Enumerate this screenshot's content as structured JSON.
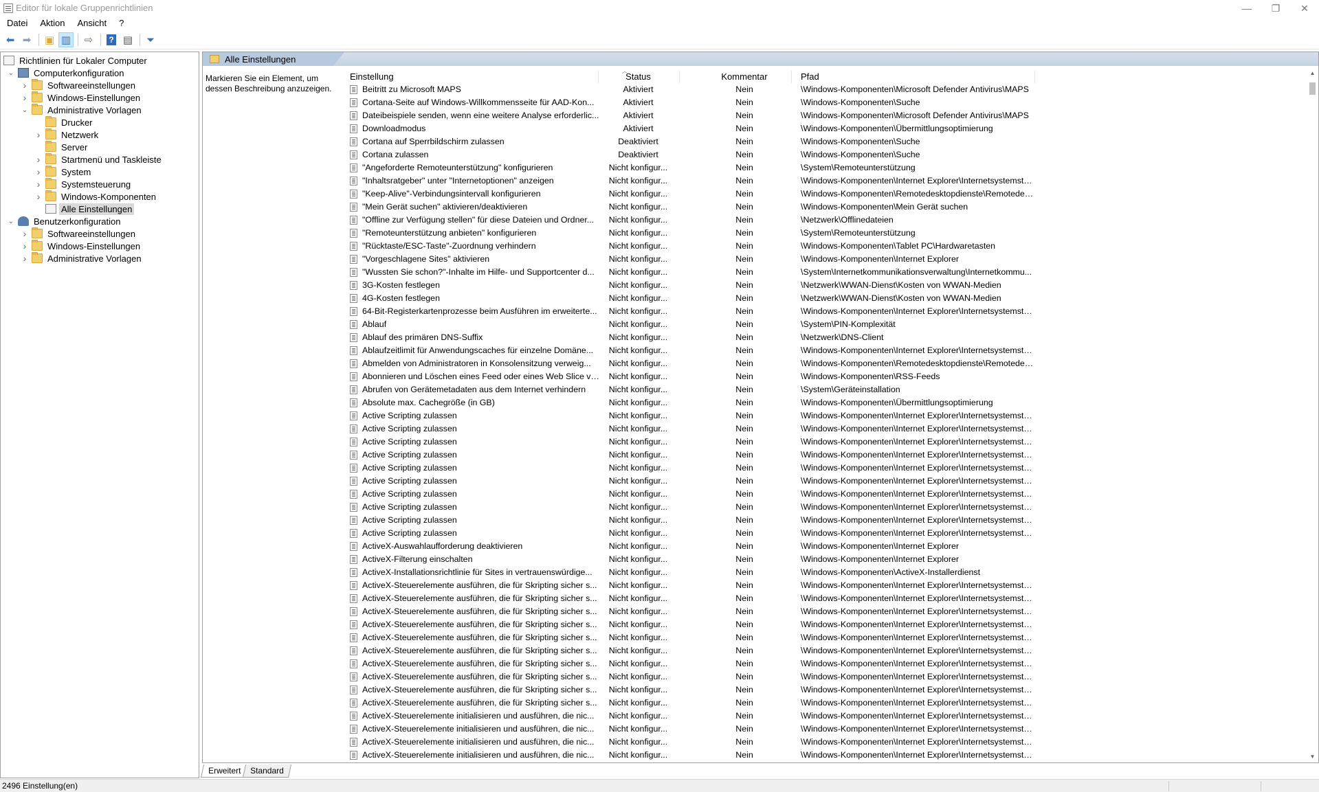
{
  "window": {
    "title": "Editor für lokale Gruppenrichtlinien",
    "controls": {
      "minimize": "—",
      "maximize": "❐",
      "close": "✕"
    }
  },
  "menu": [
    "Datei",
    "Aktion",
    "Ansicht",
    "?"
  ],
  "toolbar": {
    "buttons": [
      "back-icon",
      "forward-icon",
      "up-folder-icon",
      "show-hide-tree-icon",
      "export-list-icon",
      "help-icon",
      "properties-icon",
      "filter-icon"
    ]
  },
  "tree": {
    "root": "Richtlinien für Lokaler Computer",
    "items": [
      {
        "label": "Computerkonfiguration",
        "level": 1,
        "expander": "expanded",
        "icon": "computer-icon"
      },
      {
        "label": "Softwareeinstellungen",
        "level": 2,
        "expander": "collapsed",
        "icon": "folder-icon"
      },
      {
        "label": "Windows-Einstellungen",
        "level": 2,
        "expander": "collapsed",
        "icon": "folder-icon"
      },
      {
        "label": "Administrative Vorlagen",
        "level": 2,
        "expander": "expanded",
        "icon": "folder-icon"
      },
      {
        "label": "Drucker",
        "level": 3,
        "expander": "none",
        "icon": "folder-icon"
      },
      {
        "label": "Netzwerk",
        "level": 3,
        "expander": "collapsed",
        "icon": "folder-icon"
      },
      {
        "label": "Server",
        "level": 3,
        "expander": "none",
        "icon": "folder-icon"
      },
      {
        "label": "Startmenü und Taskleiste",
        "level": 3,
        "expander": "collapsed",
        "icon": "folder-icon"
      },
      {
        "label": "System",
        "level": 3,
        "expander": "collapsed",
        "icon": "folder-icon"
      },
      {
        "label": "Systemsteuerung",
        "level": 3,
        "expander": "collapsed",
        "icon": "folder-icon"
      },
      {
        "label": "Windows-Komponenten",
        "level": 3,
        "expander": "collapsed",
        "icon": "folder-icon"
      },
      {
        "label": "Alle Einstellungen",
        "level": 3,
        "expander": "none",
        "icon": "all-settings-icon",
        "selected": true
      },
      {
        "label": "Benutzerkonfiguration",
        "level": 1,
        "expander": "expanded",
        "icon": "user-icon"
      },
      {
        "label": "Softwareeinstellungen",
        "level": 2,
        "expander": "collapsed",
        "icon": "folder-icon"
      },
      {
        "label": "Windows-Einstellungen",
        "level": 2,
        "expander": "collapsed",
        "icon": "folder-icon"
      },
      {
        "label": "Administrative Vorlagen",
        "level": 2,
        "expander": "collapsed",
        "icon": "folder-icon"
      }
    ]
  },
  "main": {
    "header": "Alle Einstellungen",
    "description": "Markieren Sie ein Element, um dessen Beschreibung anzuzeigen.",
    "columns": [
      "Einstellung",
      "Status",
      "Kommentar",
      "Pfad"
    ],
    "rows": [
      [
        "Beitritt zu Microsoft MAPS",
        "Aktiviert",
        "Nein",
        "\\Windows-Komponenten\\Microsoft Defender Antivirus\\MAPS"
      ],
      [
        "Cortana-Seite auf Windows-Willkommensseite für AAD-Kon...",
        "Aktiviert",
        "Nein",
        "\\Windows-Komponenten\\Suche"
      ],
      [
        "Dateibeispiele senden, wenn eine weitere Analyse erforderlic...",
        "Aktiviert",
        "Nein",
        "\\Windows-Komponenten\\Microsoft Defender Antivirus\\MAPS"
      ],
      [
        "Downloadmodus",
        "Aktiviert",
        "Nein",
        "\\Windows-Komponenten\\Übermittlungsoptimierung"
      ],
      [
        "Cortana auf Sperrbildschirm zulassen",
        "Deaktiviert",
        "Nein",
        "\\Windows-Komponenten\\Suche"
      ],
      [
        "Cortana zulassen",
        "Deaktiviert",
        "Nein",
        "\\Windows-Komponenten\\Suche"
      ],
      [
        "\"Angeforderte Remoteunterstützung\" konfigurieren",
        "Nicht konfigur...",
        "Nein",
        "\\System\\Remoteunterstützung"
      ],
      [
        "\"Inhaltsratgeber\" unter \"Internetoptionen\" anzeigen",
        "Nicht konfigur...",
        "Nein",
        "\\Windows-Komponenten\\Internet Explorer\\Internetsystemste..."
      ],
      [
        "\"Keep-Alive\"-Verbindungsintervall konfigurieren",
        "Nicht konfigur...",
        "Nein",
        "\\Windows-Komponenten\\Remotedesktopdienste\\Remotedes..."
      ],
      [
        "\"Mein Gerät suchen\" aktivieren/deaktivieren",
        "Nicht konfigur...",
        "Nein",
        "\\Windows-Komponenten\\Mein Gerät suchen"
      ],
      [
        "\"Offline zur Verfügung stellen\" für diese Dateien und Ordner...",
        "Nicht konfigur...",
        "Nein",
        "\\Netzwerk\\Offlinedateien"
      ],
      [
        "\"Remoteunterstützung anbieten\" konfigurieren",
        "Nicht konfigur...",
        "Nein",
        "\\System\\Remoteunterstützung"
      ],
      [
        "\"Rücktaste/ESC-Taste\"-Zuordnung verhindern",
        "Nicht konfigur...",
        "Nein",
        "\\Windows-Komponenten\\Tablet PC\\Hardwaretasten"
      ],
      [
        "\"Vorgeschlagene Sites\" aktivieren",
        "Nicht konfigur...",
        "Nein",
        "\\Windows-Komponenten\\Internet Explorer"
      ],
      [
        "\"Wussten Sie schon?\"-Inhalte im Hilfe- und Supportcenter d...",
        "Nicht konfigur...",
        "Nein",
        "\\System\\Internetkommunikationsverwaltung\\Internetkommu..."
      ],
      [
        "3G-Kosten festlegen",
        "Nicht konfigur...",
        "Nein",
        "\\Netzwerk\\WWAN-Dienst\\Kosten von WWAN-Medien"
      ],
      [
        "4G-Kosten festlegen",
        "Nicht konfigur...",
        "Nein",
        "\\Netzwerk\\WWAN-Dienst\\Kosten von WWAN-Medien"
      ],
      [
        "64-Bit-Registerkartenprozesse beim Ausführen im erweiterte...",
        "Nicht konfigur...",
        "Nein",
        "\\Windows-Komponenten\\Internet Explorer\\Internetsystemste..."
      ],
      [
        "Ablauf",
        "Nicht konfigur...",
        "Nein",
        "\\System\\PIN-Komplexität"
      ],
      [
        "Ablauf des primären DNS-Suffix",
        "Nicht konfigur...",
        "Nein",
        "\\Netzwerk\\DNS-Client"
      ],
      [
        "Ablaufzeitlimit für Anwendungscaches für einzelne Domäne...",
        "Nicht konfigur...",
        "Nein",
        "\\Windows-Komponenten\\Internet Explorer\\Internetsystemste..."
      ],
      [
        "Abmelden von Administratoren in Konsolensitzung verweig...",
        "Nicht konfigur...",
        "Nein",
        "\\Windows-Komponenten\\Remotedesktopdienste\\Remotedes..."
      ],
      [
        "Abonnieren und Löschen eines Feed oder eines Web Slice ve...",
        "Nicht konfigur...",
        "Nein",
        "\\Windows-Komponenten\\RSS-Feeds"
      ],
      [
        "Abrufen von Gerätemetadaten aus dem Internet verhindern",
        "Nicht konfigur...",
        "Nein",
        "\\System\\Geräteinstallation"
      ],
      [
        "Absolute max. Cachegröße (in GB)",
        "Nicht konfigur...",
        "Nein",
        "\\Windows-Komponenten\\Übermittlungsoptimierung"
      ],
      [
        "Active Scripting zulassen",
        "Nicht konfigur...",
        "Nein",
        "\\Windows-Komponenten\\Internet Explorer\\Internetsystemste..."
      ],
      [
        "Active Scripting zulassen",
        "Nicht konfigur...",
        "Nein",
        "\\Windows-Komponenten\\Internet Explorer\\Internetsystemste..."
      ],
      [
        "Active Scripting zulassen",
        "Nicht konfigur...",
        "Nein",
        "\\Windows-Komponenten\\Internet Explorer\\Internetsystemste..."
      ],
      [
        "Active Scripting zulassen",
        "Nicht konfigur...",
        "Nein",
        "\\Windows-Komponenten\\Internet Explorer\\Internetsystemste..."
      ],
      [
        "Active Scripting zulassen",
        "Nicht konfigur...",
        "Nein",
        "\\Windows-Komponenten\\Internet Explorer\\Internetsystemste..."
      ],
      [
        "Active Scripting zulassen",
        "Nicht konfigur...",
        "Nein",
        "\\Windows-Komponenten\\Internet Explorer\\Internetsystemste..."
      ],
      [
        "Active Scripting zulassen",
        "Nicht konfigur...",
        "Nein",
        "\\Windows-Komponenten\\Internet Explorer\\Internetsystemste..."
      ],
      [
        "Active Scripting zulassen",
        "Nicht konfigur...",
        "Nein",
        "\\Windows-Komponenten\\Internet Explorer\\Internetsystemste..."
      ],
      [
        "Active Scripting zulassen",
        "Nicht konfigur...",
        "Nein",
        "\\Windows-Komponenten\\Internet Explorer\\Internetsystemste..."
      ],
      [
        "Active Scripting zulassen",
        "Nicht konfigur...",
        "Nein",
        "\\Windows-Komponenten\\Internet Explorer\\Internetsystemste..."
      ],
      [
        "ActiveX-Auswahlaufforderung deaktivieren",
        "Nicht konfigur...",
        "Nein",
        "\\Windows-Komponenten\\Internet Explorer"
      ],
      [
        "ActiveX-Filterung einschalten",
        "Nicht konfigur...",
        "Nein",
        "\\Windows-Komponenten\\Internet Explorer"
      ],
      [
        "ActiveX-Installationsrichtlinie für Sites in vertrauenswürdige...",
        "Nicht konfigur...",
        "Nein",
        "\\Windows-Komponenten\\ActiveX-Installerdienst"
      ],
      [
        "ActiveX-Steuerelemente ausführen, die für Skripting sicher s...",
        "Nicht konfigur...",
        "Nein",
        "\\Windows-Komponenten\\Internet Explorer\\Internetsystemste..."
      ],
      [
        "ActiveX-Steuerelemente ausführen, die für Skripting sicher s...",
        "Nicht konfigur...",
        "Nein",
        "\\Windows-Komponenten\\Internet Explorer\\Internetsystemste..."
      ],
      [
        "ActiveX-Steuerelemente ausführen, die für Skripting sicher s...",
        "Nicht konfigur...",
        "Nein",
        "\\Windows-Komponenten\\Internet Explorer\\Internetsystemste..."
      ],
      [
        "ActiveX-Steuerelemente ausführen, die für Skripting sicher s...",
        "Nicht konfigur...",
        "Nein",
        "\\Windows-Komponenten\\Internet Explorer\\Internetsystemste..."
      ],
      [
        "ActiveX-Steuerelemente ausführen, die für Skripting sicher s...",
        "Nicht konfigur...",
        "Nein",
        "\\Windows-Komponenten\\Internet Explorer\\Internetsystemste..."
      ],
      [
        "ActiveX-Steuerelemente ausführen, die für Skripting sicher s...",
        "Nicht konfigur...",
        "Nein",
        "\\Windows-Komponenten\\Internet Explorer\\Internetsystemste..."
      ],
      [
        "ActiveX-Steuerelemente ausführen, die für Skripting sicher s...",
        "Nicht konfigur...",
        "Nein",
        "\\Windows-Komponenten\\Internet Explorer\\Internetsystemste..."
      ],
      [
        "ActiveX-Steuerelemente ausführen, die für Skripting sicher s...",
        "Nicht konfigur...",
        "Nein",
        "\\Windows-Komponenten\\Internet Explorer\\Internetsystemste..."
      ],
      [
        "ActiveX-Steuerelemente ausführen, die für Skripting sicher s...",
        "Nicht konfigur...",
        "Nein",
        "\\Windows-Komponenten\\Internet Explorer\\Internetsystemste..."
      ],
      [
        "ActiveX-Steuerelemente ausführen, die für Skripting sicher s...",
        "Nicht konfigur...",
        "Nein",
        "\\Windows-Komponenten\\Internet Explorer\\Internetsystemste..."
      ],
      [
        "ActiveX-Steuerelemente initialisieren und ausführen, die nic...",
        "Nicht konfigur...",
        "Nein",
        "\\Windows-Komponenten\\Internet Explorer\\Internetsystemste..."
      ],
      [
        "ActiveX-Steuerelemente initialisieren und ausführen, die nic...",
        "Nicht konfigur...",
        "Nein",
        "\\Windows-Komponenten\\Internet Explorer\\Internetsystemste..."
      ],
      [
        "ActiveX-Steuerelemente initialisieren und ausführen, die nic...",
        "Nicht konfigur...",
        "Nein",
        "\\Windows-Komponenten\\Internet Explorer\\Internetsystemste..."
      ],
      [
        "ActiveX-Steuerelemente initialisieren und ausführen, die nic...",
        "Nicht konfigur...",
        "Nein",
        "\\Windows-Komponenten\\Internet Explorer\\Internetsystemste..."
      ]
    ]
  },
  "bottom_tabs": [
    "Erweitert",
    "Standard"
  ],
  "status": "2496 Einstellung(en)"
}
